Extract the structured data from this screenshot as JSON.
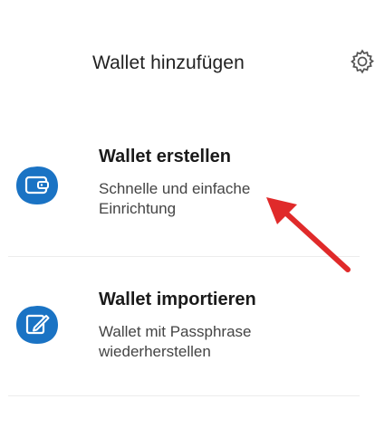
{
  "header": {
    "title": "Wallet hinzufügen",
    "settings_icon": "gear-icon"
  },
  "options": [
    {
      "title": "Wallet erstellen",
      "subtitle": "Schnelle und einfache Einrichtung",
      "icon": "wallet-icon"
    },
    {
      "title": "Wallet importieren",
      "subtitle": "Wallet mit Passphrase wiederherstellen",
      "icon": "edit-icon"
    }
  ],
  "colors": {
    "accent": "#1a73c4",
    "annotation_arrow": "#e02a2a"
  }
}
